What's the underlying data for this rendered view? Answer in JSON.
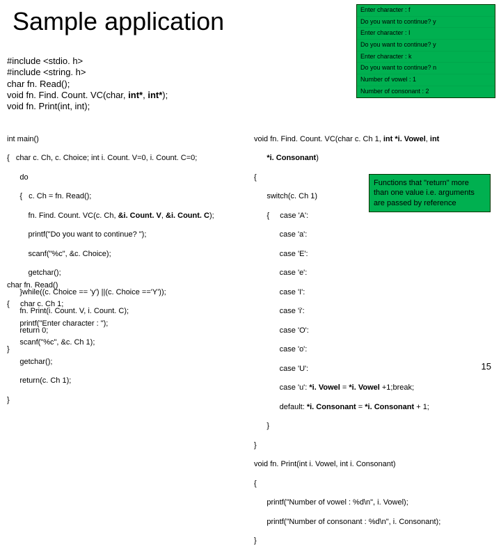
{
  "title": "Sample application",
  "page_number": "15",
  "console": {
    "rows": [
      "Enter character : f",
      "Do you want to continue? y",
      "Enter character : I",
      "Do you want to continue? y",
      "Enter character : k",
      "Do you want to continue? n",
      "Number of vowel : 1",
      "Number of consonant : 2"
    ]
  },
  "decl": {
    "l1": "#include <stdio. h>",
    "l2": "#include <string. h>",
    "l3": "char fn. Read();",
    "l4_a": "void fn. Find. Count. VC(char, ",
    "l4_b": "int*",
    "l4_c": ", ",
    "l4_d": "int*",
    "l4_e": ");",
    "l5": "void fn. Print(int, int);"
  },
  "main": {
    "l1": "int main()",
    "l2": "{   char c. Ch, c. Choice; int i. Count. V=0, i. Count. C=0;",
    "l3": "      do",
    "l4": "      {   c. Ch = fn. Read();",
    "l5a": "          fn. Find. Count. VC(c. Ch, ",
    "l5b": "&i. Count. V",
    "l5c": ", ",
    "l5d": "&i. Count. C",
    "l5e": ");",
    "l6": "          printf(\"Do you want to continue? \");",
    "l7": "          scanf(\"%c\", &c. Choice);",
    "l8": "          getchar();",
    "l9": "      }while((c. Choice == 'y') ||(c. Choice =='Y'));",
    "l10": "      fn. Print(i. Count. V, i. Count. C);",
    "l11": "      return 0;",
    "l12": "}"
  },
  "read": {
    "l1": "char fn. Read()",
    "l2": "{     char c. Ch 1;",
    "l3": "      printf(\"Enter character : \");",
    "l4": "      scanf(\"%c\", &c. Ch 1);",
    "l5": "      getchar();",
    "l6": "      return(c. Ch 1);",
    "l7": "}"
  },
  "right": {
    "l1a": "void fn. Find. Count. VC(char c. Ch 1, ",
    "l1b": "int *i. Vowel",
    "l1c": ", ",
    "l1d": "int",
    "l2a": "      *i. Consonant",
    "l2b": ")",
    "l3": "{",
    "l4": "      switch(c. Ch 1)",
    "l5": "      {     case 'A':",
    "l6": "            case 'a':",
    "l7": "            case 'E':",
    "l8": "            case 'e':",
    "l9": "            case 'I':",
    "l10": "            case 'i':",
    "l11": "            case 'O':",
    "l12": "            case 'o':",
    "l13": "            case 'U':",
    "l14a": "            case 'u': ",
    "l14b": "*i. Vowel",
    "l14c": " = ",
    "l14d": "*i. Vowel",
    "l14e": " +1;break;",
    "l15a": "            default: ",
    "l15b": "*i. Consonant",
    "l15c": " = ",
    "l15d": "*i. Consonant",
    "l15e": " + 1;",
    "l16": "      }",
    "l17": "}",
    "l18": "void fn. Print(int i. Vowel, int i. Consonant)",
    "l19": "{",
    "l20": "      printf(\"Number of vowel : %d\\n\", i. Vowel);",
    "l21": "      printf(\"Number of consonant : %d\\n\", i. Consonant);",
    "l22": "}"
  },
  "callout": {
    "text": "Functions that \"return\" more than one value i.e. arguments are passed by reference"
  }
}
